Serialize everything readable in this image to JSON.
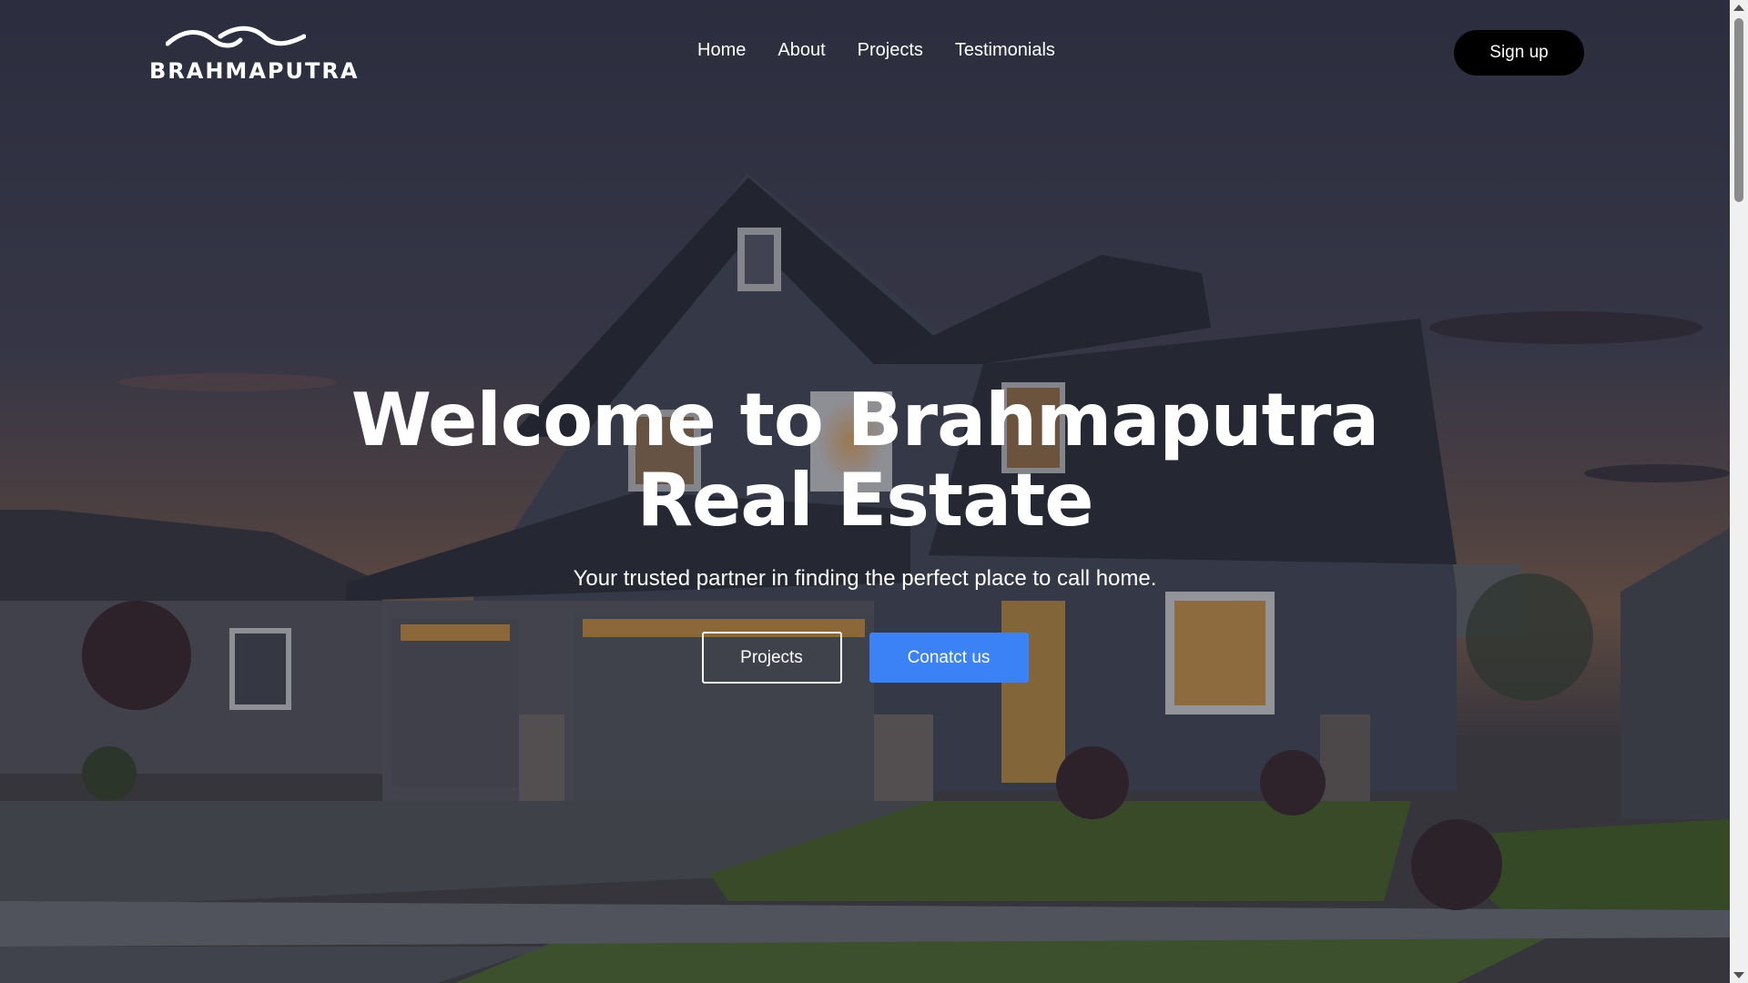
{
  "brand": {
    "name": "BRAHMAPUTRA",
    "logo_icon": "wave-logo-icon"
  },
  "nav": {
    "links": [
      "Home",
      "About",
      "Projects",
      "Testimonials"
    ],
    "signup_label": "Sign up"
  },
  "hero": {
    "title_line1": "Welcome to Brahmaputra",
    "title_line2": "Real Estate",
    "subtitle": "Your trusted partner in finding the perfect place to call home.",
    "primary_action": "Projects",
    "secondary_action": "Conatct us",
    "background": "house-at-dusk-image"
  },
  "colors": {
    "accent": "#3b82f6",
    "signup_bg": "#000000",
    "text": "#ffffff"
  }
}
